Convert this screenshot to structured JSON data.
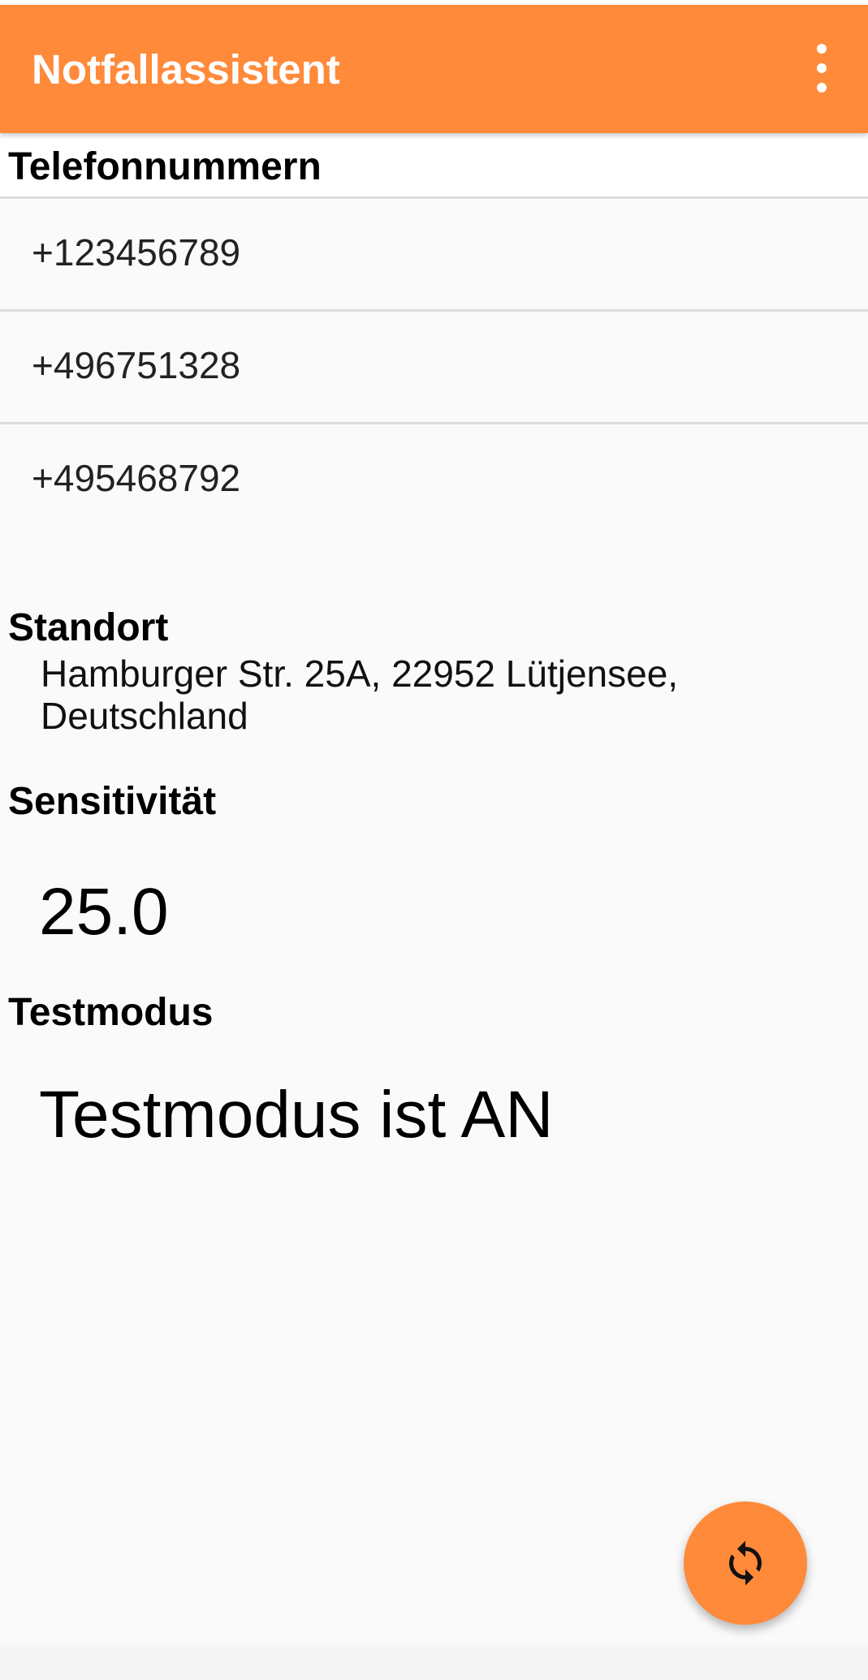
{
  "app_bar": {
    "title": "Notfallassistent",
    "menu_icon": "more-vert-icon",
    "background_color": "#ff8a3a"
  },
  "phone_section": {
    "title": "Telefonnummern",
    "numbers": [
      "+123456789",
      "+496751328",
      "+495468792"
    ]
  },
  "location_section": {
    "title": "Standort",
    "address": "Hamburger Str. 25A, 22952 Lütjensee, Deutschland"
  },
  "sensitivity_section": {
    "title": "Sensitivität",
    "value": "25.0"
  },
  "test_mode_section": {
    "title": "Testmodus",
    "status": "Testmodus ist AN"
  },
  "fab": {
    "icon": "refresh-icon"
  }
}
